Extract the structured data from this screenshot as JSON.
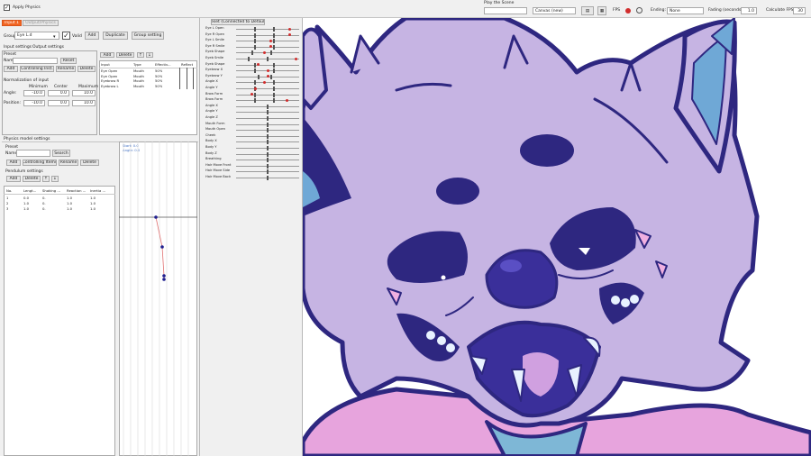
{
  "window": {
    "apply_physics_label": "Apply Physics"
  },
  "tabs": [
    {
      "label": "Input 1",
      "active": true
    },
    {
      "label": "Output/Physics",
      "active": false
    }
  ],
  "group": {
    "label": "Group:",
    "value": "Eye L.d",
    "valid_label": "Valid",
    "add_label": "Add",
    "duplicate_label": "Duplicate",
    "group_settings_label": "Group setting"
  },
  "input_settings": {
    "tab1": "Input settings",
    "tab2": "Output settings",
    "preset_label": "Preset",
    "name_label": "Name:",
    "reset_label": "Reset",
    "buttons": [
      "Add",
      "Controlling Inst.",
      "Rename",
      "Delete"
    ],
    "normalization_label": "Normalization of input",
    "col_headers": [
      "Minimum",
      "Center",
      "Maximum"
    ],
    "rows": [
      {
        "label": "Angle:",
        "values": [
          "-10.0",
          "0.0",
          "10.0"
        ]
      },
      {
        "label": "Position:",
        "values": [
          "-10.0",
          "0.0",
          "10.0"
        ]
      }
    ]
  },
  "input_table": {
    "add_label": "Add",
    "delete_label": "Delete",
    "headers": [
      "Input",
      "Type",
      "Effectiv...",
      "Reflect"
    ],
    "rows": [
      [
        "Eye Open",
        "Mouth",
        "50%"
      ],
      [
        "Eye Open",
        "Mouth",
        "50%"
      ],
      [
        "Eyebrow R",
        "Mouth",
        "50%"
      ],
      [
        "Eyebrow L",
        "Mouth",
        "50%"
      ]
    ]
  },
  "physics": {
    "header": "Physics model settings",
    "preset_label": "Preset",
    "name_label": "Name:",
    "search_label": "Search",
    "buttons": [
      "Add",
      "Controlling Items",
      "Rename",
      "Delete"
    ],
    "pendulum_label": "Pendulum settings",
    "pendulum_buttons": [
      "Add",
      "Delete"
    ],
    "table_headers": [
      "No.",
      "Lengt...",
      "Shaking ...",
      "Reaction ...",
      "Inertia ..."
    ],
    "rows": [
      [
        "1",
        "0.0",
        "0.",
        "1.0",
        "1.0"
      ],
      [
        "2",
        "1.0",
        "0.",
        "1.0",
        "1.0"
      ],
      [
        "3",
        "1.0",
        "0.",
        "1.0",
        "1.0"
      ]
    ],
    "graph_readout": [
      "Start:  0.0",
      "Angle:  0.0"
    ]
  },
  "params": {
    "reset_label": "Reset (Connected to Default)",
    "items": [
      {
        "name": "Eye L Open",
        "thumbs": [
          0.3,
          0.6
        ],
        "red": 0.85
      },
      {
        "name": "Eye R Open",
        "thumbs": [
          0.3,
          0.6
        ],
        "red": 0.85
      },
      {
        "name": "Eye L Smile",
        "thumbs": [
          0.3,
          0.6
        ],
        "red": 0.55
      },
      {
        "name": "Eye R Smile",
        "thumbs": [
          0.3,
          0.6
        ],
        "red": 0.55
      },
      {
        "name": "Eyeb Shape",
        "thumbs": [
          0.25,
          0.55
        ],
        "red": 0.45
      },
      {
        "name": "Eyeb Smile",
        "thumbs": [
          0.2,
          0.5
        ],
        "red": 0.95
      },
      {
        "name": "Eyeb Shape",
        "thumbs": [
          0.3,
          0.6
        ],
        "red": 0.35
      },
      {
        "name": "Eyebrow X",
        "thumbs": [
          0.3,
          0.6
        ],
        "red": 0.5
      },
      {
        "name": "Eyebrow Y",
        "thumbs": [
          0.35,
          0.55
        ],
        "red": 0.5
      },
      {
        "name": "Angle X",
        "thumbs": [
          0.3,
          0.6
        ],
        "red": 0.45
      },
      {
        "name": "Angle Y",
        "thumbs": [
          0.3,
          0.6
        ],
        "red": 0.3
      },
      {
        "name": "Brow Form",
        "thumbs": [
          0.3,
          0.6
        ],
        "red": 0.25
      },
      {
        "name": "Brow Form",
        "thumbs": [
          0.3,
          0.6
        ],
        "red": 0.8
      },
      {
        "name": "Angle X",
        "thumbs": [
          0.5
        ],
        "red": null
      },
      {
        "name": "Angle Y",
        "thumbs": [
          0.5
        ],
        "red": null
      },
      {
        "name": "Angle Z",
        "thumbs": [
          0.5
        ],
        "red": null
      },
      {
        "name": "Mouth Form",
        "thumbs": [
          0.5
        ],
        "red": null
      },
      {
        "name": "Mouth Open",
        "thumbs": [
          0.5
        ],
        "red": null
      },
      {
        "name": "Cheek",
        "thumbs": [
          0.5
        ],
        "red": null
      },
      {
        "name": "Body X",
        "thumbs": [
          0.5
        ],
        "red": null
      },
      {
        "name": "Body Y",
        "thumbs": [
          0.5
        ],
        "red": null
      },
      {
        "name": "Body Z",
        "thumbs": [
          0.5
        ],
        "red": null
      },
      {
        "name": "Breathing",
        "thumbs": [
          0.5
        ],
        "red": null
      },
      {
        "name": "Hair Move Front",
        "thumbs": [
          0.5
        ],
        "red": null
      },
      {
        "name": "Hair Move Side",
        "thumbs": [
          0.5
        ],
        "red": null
      },
      {
        "name": "Hair Move Back",
        "thumbs": [
          0.5
        ],
        "red": null
      }
    ]
  },
  "toolbar": {
    "play_scene_label": "Play the Scene",
    "scene_value": "",
    "mode_value": "Canvas (new)",
    "fps_label": "FPS",
    "ending_label": "Ending:",
    "ending_value": "None",
    "fade_label": "Fading (seconds):",
    "fade_value": "1.0",
    "calculate_label": "Calculate FPS:",
    "calculate_value": "30"
  }
}
